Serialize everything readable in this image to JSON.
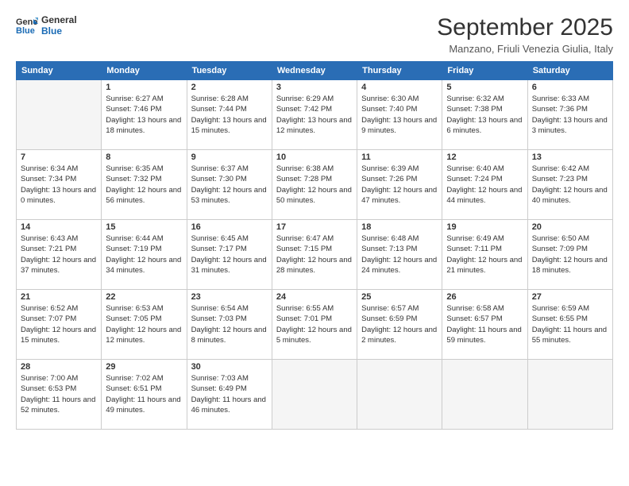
{
  "header": {
    "logo_line1": "General",
    "logo_line2": "Blue",
    "title": "September 2025",
    "subtitle": "Manzano, Friuli Venezia Giulia, Italy"
  },
  "days_of_week": [
    "Sunday",
    "Monday",
    "Tuesday",
    "Wednesday",
    "Thursday",
    "Friday",
    "Saturday"
  ],
  "weeks": [
    [
      {
        "day": "",
        "sunrise": "",
        "sunset": "",
        "daylight": "",
        "empty": true
      },
      {
        "day": "1",
        "sunrise": "Sunrise: 6:27 AM",
        "sunset": "Sunset: 7:46 PM",
        "daylight": "Daylight: 13 hours and 18 minutes."
      },
      {
        "day": "2",
        "sunrise": "Sunrise: 6:28 AM",
        "sunset": "Sunset: 7:44 PM",
        "daylight": "Daylight: 13 hours and 15 minutes."
      },
      {
        "day": "3",
        "sunrise": "Sunrise: 6:29 AM",
        "sunset": "Sunset: 7:42 PM",
        "daylight": "Daylight: 13 hours and 12 minutes."
      },
      {
        "day": "4",
        "sunrise": "Sunrise: 6:30 AM",
        "sunset": "Sunset: 7:40 PM",
        "daylight": "Daylight: 13 hours and 9 minutes."
      },
      {
        "day": "5",
        "sunrise": "Sunrise: 6:32 AM",
        "sunset": "Sunset: 7:38 PM",
        "daylight": "Daylight: 13 hours and 6 minutes."
      },
      {
        "day": "6",
        "sunrise": "Sunrise: 6:33 AM",
        "sunset": "Sunset: 7:36 PM",
        "daylight": "Daylight: 13 hours and 3 minutes."
      }
    ],
    [
      {
        "day": "7",
        "sunrise": "Sunrise: 6:34 AM",
        "sunset": "Sunset: 7:34 PM",
        "daylight": "Daylight: 13 hours and 0 minutes."
      },
      {
        "day": "8",
        "sunrise": "Sunrise: 6:35 AM",
        "sunset": "Sunset: 7:32 PM",
        "daylight": "Daylight: 12 hours and 56 minutes."
      },
      {
        "day": "9",
        "sunrise": "Sunrise: 6:37 AM",
        "sunset": "Sunset: 7:30 PM",
        "daylight": "Daylight: 12 hours and 53 minutes."
      },
      {
        "day": "10",
        "sunrise": "Sunrise: 6:38 AM",
        "sunset": "Sunset: 7:28 PM",
        "daylight": "Daylight: 12 hours and 50 minutes."
      },
      {
        "day": "11",
        "sunrise": "Sunrise: 6:39 AM",
        "sunset": "Sunset: 7:26 PM",
        "daylight": "Daylight: 12 hours and 47 minutes."
      },
      {
        "day": "12",
        "sunrise": "Sunrise: 6:40 AM",
        "sunset": "Sunset: 7:24 PM",
        "daylight": "Daylight: 12 hours and 44 minutes."
      },
      {
        "day": "13",
        "sunrise": "Sunrise: 6:42 AM",
        "sunset": "Sunset: 7:23 PM",
        "daylight": "Daylight: 12 hours and 40 minutes."
      }
    ],
    [
      {
        "day": "14",
        "sunrise": "Sunrise: 6:43 AM",
        "sunset": "Sunset: 7:21 PM",
        "daylight": "Daylight: 12 hours and 37 minutes."
      },
      {
        "day": "15",
        "sunrise": "Sunrise: 6:44 AM",
        "sunset": "Sunset: 7:19 PM",
        "daylight": "Daylight: 12 hours and 34 minutes."
      },
      {
        "day": "16",
        "sunrise": "Sunrise: 6:45 AM",
        "sunset": "Sunset: 7:17 PM",
        "daylight": "Daylight: 12 hours and 31 minutes."
      },
      {
        "day": "17",
        "sunrise": "Sunrise: 6:47 AM",
        "sunset": "Sunset: 7:15 PM",
        "daylight": "Daylight: 12 hours and 28 minutes."
      },
      {
        "day": "18",
        "sunrise": "Sunrise: 6:48 AM",
        "sunset": "Sunset: 7:13 PM",
        "daylight": "Daylight: 12 hours and 24 minutes."
      },
      {
        "day": "19",
        "sunrise": "Sunrise: 6:49 AM",
        "sunset": "Sunset: 7:11 PM",
        "daylight": "Daylight: 12 hours and 21 minutes."
      },
      {
        "day": "20",
        "sunrise": "Sunrise: 6:50 AM",
        "sunset": "Sunset: 7:09 PM",
        "daylight": "Daylight: 12 hours and 18 minutes."
      }
    ],
    [
      {
        "day": "21",
        "sunrise": "Sunrise: 6:52 AM",
        "sunset": "Sunset: 7:07 PM",
        "daylight": "Daylight: 12 hours and 15 minutes."
      },
      {
        "day": "22",
        "sunrise": "Sunrise: 6:53 AM",
        "sunset": "Sunset: 7:05 PM",
        "daylight": "Daylight: 12 hours and 12 minutes."
      },
      {
        "day": "23",
        "sunrise": "Sunrise: 6:54 AM",
        "sunset": "Sunset: 7:03 PM",
        "daylight": "Daylight: 12 hours and 8 minutes."
      },
      {
        "day": "24",
        "sunrise": "Sunrise: 6:55 AM",
        "sunset": "Sunset: 7:01 PM",
        "daylight": "Daylight: 12 hours and 5 minutes."
      },
      {
        "day": "25",
        "sunrise": "Sunrise: 6:57 AM",
        "sunset": "Sunset: 6:59 PM",
        "daylight": "Daylight: 12 hours and 2 minutes."
      },
      {
        "day": "26",
        "sunrise": "Sunrise: 6:58 AM",
        "sunset": "Sunset: 6:57 PM",
        "daylight": "Daylight: 11 hours and 59 minutes."
      },
      {
        "day": "27",
        "sunrise": "Sunrise: 6:59 AM",
        "sunset": "Sunset: 6:55 PM",
        "daylight": "Daylight: 11 hours and 55 minutes."
      }
    ],
    [
      {
        "day": "28",
        "sunrise": "Sunrise: 7:00 AM",
        "sunset": "Sunset: 6:53 PM",
        "daylight": "Daylight: 11 hours and 52 minutes."
      },
      {
        "day": "29",
        "sunrise": "Sunrise: 7:02 AM",
        "sunset": "Sunset: 6:51 PM",
        "daylight": "Daylight: 11 hours and 49 minutes."
      },
      {
        "day": "30",
        "sunrise": "Sunrise: 7:03 AM",
        "sunset": "Sunset: 6:49 PM",
        "daylight": "Daylight: 11 hours and 46 minutes."
      },
      {
        "day": "",
        "sunrise": "",
        "sunset": "",
        "daylight": "",
        "empty": true
      },
      {
        "day": "",
        "sunrise": "",
        "sunset": "",
        "daylight": "",
        "empty": true
      },
      {
        "day": "",
        "sunrise": "",
        "sunset": "",
        "daylight": "",
        "empty": true
      },
      {
        "day": "",
        "sunrise": "",
        "sunset": "",
        "daylight": "",
        "empty": true
      }
    ]
  ]
}
